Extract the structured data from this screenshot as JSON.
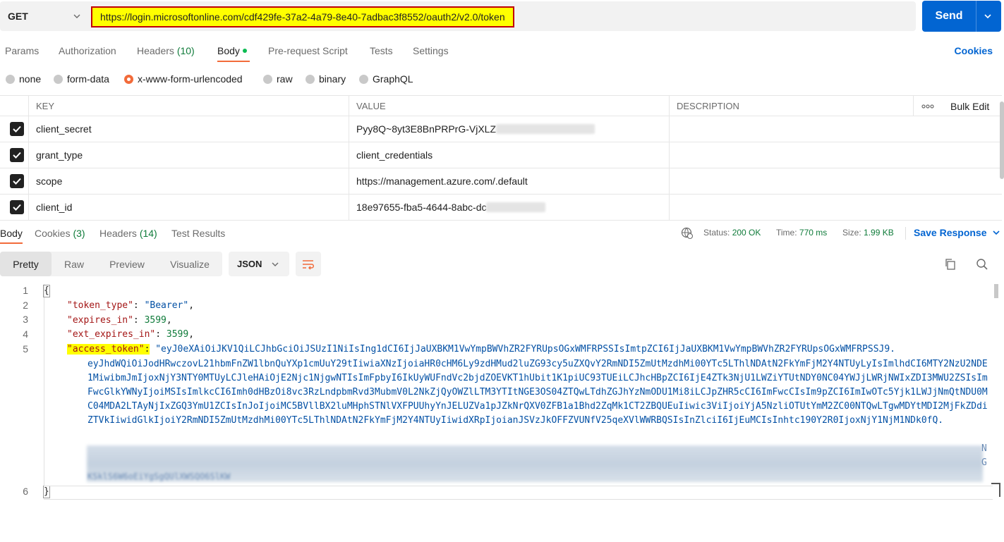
{
  "request": {
    "method": "GET",
    "url": "https://login.microsoftonline.com/cdf429fe-37a2-4a79-8e40-7adbac3f8552/oauth2/v2.0/token",
    "send_label": "Send"
  },
  "req_tabs": {
    "params": "Params",
    "authorization": "Authorization",
    "headers": "Headers",
    "headers_count": "(10)",
    "body": "Body",
    "prerequest": "Pre-request Script",
    "tests": "Tests",
    "settings": "Settings",
    "cookies": "Cookies"
  },
  "body_types": {
    "none": "none",
    "form_data": "form-data",
    "urlencoded": "x-www-form-urlencoded",
    "raw": "raw",
    "binary": "binary",
    "graphql": "GraphQL",
    "selected": "x-www-form-urlencoded"
  },
  "params_table": {
    "headers": {
      "key": "KEY",
      "value": "VALUE",
      "description": "DESCRIPTION",
      "bulk_edit": "Bulk Edit"
    },
    "rows": [
      {
        "key": "client_secret",
        "value": "Pyy8Q~8yt3E8BnPRPrG-VjXLZ",
        "checked": true
      },
      {
        "key": "grant_type",
        "value": "client_credentials",
        "checked": true
      },
      {
        "key": "scope",
        "value": "https://management.azure.com/.default",
        "checked": true
      },
      {
        "key": "client_id",
        "value": "18e97655-fba5-4644-8abc-dc",
        "checked": true
      }
    ]
  },
  "response": {
    "tabs": {
      "body": "Body",
      "cookies": "Cookies",
      "cookies_count": "(3)",
      "headers": "Headers",
      "headers_count": "(14)",
      "tests": "Test Results"
    },
    "status_label": "Status:",
    "status_value": "200 OK",
    "time_label": "Time:",
    "time_value": "770 ms",
    "size_label": "Size:",
    "size_value": "1.99 KB",
    "save_label": "Save Response",
    "views": {
      "pretty": "Pretty",
      "raw": "Raw",
      "preview": "Preview",
      "visualize": "Visualize"
    },
    "format": "JSON"
  },
  "code": {
    "line_numbers": [
      "1",
      "2",
      "3",
      "4",
      "5",
      "6"
    ],
    "open_brace": "{",
    "close_brace": "}",
    "token_type_key": "\"token_type\"",
    "token_type_val": "\"Bearer\"",
    "expires_in_key": "\"expires_in\"",
    "expires_in_val": "3599",
    "ext_expires_in_key": "\"ext_expires_in\"",
    "ext_expires_in_val": "3599",
    "access_token_key": "\"access_token\"",
    "access_token_first": "\"eyJ0eXAiOiJKV1QiLCJhbGciOiJSUzI1NiIsIng1dCI6IjJaUXBKM1VwYmpBWVhZR2FYRUpsOGxWMFRPSSIsImtpZCI6IjJaUXBKM1VwYmpBWVhZR2FYRUpsOGxWMFRPSSJ9.",
    "access_token_wrapped": "eyJhdWQiOiJodHRwczovL21hbmFnZW1lbnQuYXp1cmUuY29tIiwiaXNzIjoiaHR0cHM6Ly9zdHMud2luZG93cy5uZXQvY2RmNDI5ZmUtMzdhMi00YTc5LThlNDAtN2FkYmFjM2Y4NTUyLyIsImlhdCI6MTY2NzU2NDE1MiwibmJmIjoxNjY3NTY0MTUyLCJleHAiOjE2Njc1NjgwNTIsImFpbyI6IkUyWUFndVc2bjdZOEVKT1hUbit1K1piUC93TUEiLCJhcHBpZCI6IjE4ZTk3NjU1LWZiYTUtNDY0NC04YWJjLWRjNWIxZDI3MWU2ZSIsImFwcGlkYWNyIjoiMSIsImlkcCI6Imh0dHBzOi8vc3RzLndpbmRvd3MubmV0L2NkZjQyOWZlLTM3YTItNGE3OS04ZTQwLTdhZGJhYzNmODU1Mi8iLCJpZHR5cCI6ImFwcCIsIm9pZCI6ImIwOTc5Yjk1LWJjNmQtNDU0MC04MDA2LTAyNjIxZGQ3YmU1ZCIsInJoIjoiMC5BVllBX2luMHphSTNlVXFPUUhyYnJELUZVa1pJZkNrQXV0ZFB1a1Bhd2ZqMk1CT2ZBQUEuIiwic3ViIjoiYjA5NzliOTUtYmM2ZC00NTQwLTgwMDYtMDI2MjFkZDdiZTVkIiwidGlkIjoiY2RmNDI5ZmUtMzdhMi00YTc5LThlNDAtN2FkYmFjM2Y4NTUyIiwidXRpIjoianJSVzJkOFFZVUNfV25qeXVlWWRBQSIsInZlciI6IjEuMCIsInhtc190Y2R0IjoxNjY1NjM1NDk0fQ.",
    "blur_trail_1": "N",
    "blur_trail_2": "G",
    "blur_trail_3": "KSklS6W6oEiYgSgQUlXWSQO6SlKW"
  }
}
